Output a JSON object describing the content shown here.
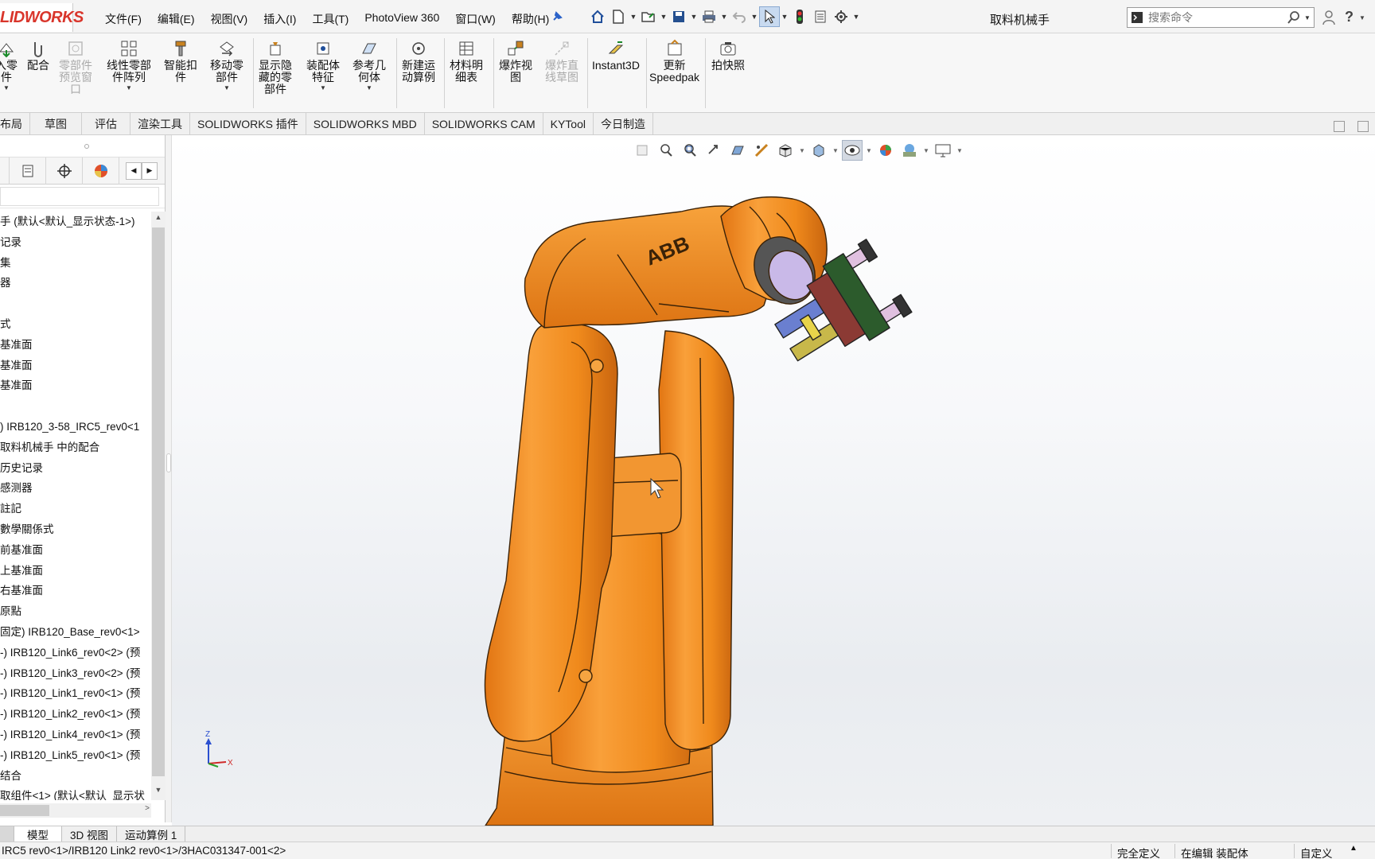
{
  "app": {
    "logo_text": "LIDWORKS",
    "document_title": "取料机械手"
  },
  "menu": [
    "文件(F)",
    "编辑(E)",
    "视图(V)",
    "插入(I)",
    "工具(T)",
    "PhotoView 360",
    "窗口(W)",
    "帮助(H)"
  ],
  "search": {
    "placeholder": "搜索命令"
  },
  "ribbon": {
    "buttons": [
      {
        "label": "入零\n件",
        "icon": "insert-part-icon"
      },
      {
        "label": "配合",
        "icon": "mate-icon"
      },
      {
        "label": "零部件\n预览窗\n口",
        "icon": "component-preview-icon",
        "disabled": true
      },
      {
        "label": "线性零部\n件阵列",
        "icon": "linear-pattern-icon"
      },
      {
        "label": "智能扣\n件",
        "icon": "smart-fastener-icon"
      },
      {
        "label": "移动零\n部件",
        "icon": "move-component-icon"
      },
      {
        "label": "显示隐\n藏的零\n部件",
        "icon": "show-hidden-icon"
      },
      {
        "label": "装配体\n特征",
        "icon": "assembly-feature-icon"
      },
      {
        "label": "参考几\n何体",
        "icon": "reference-geometry-icon"
      },
      {
        "label": "新建运\n动算例",
        "icon": "new-motion-study-icon"
      },
      {
        "label": "材料明\n细表",
        "icon": "bom-icon"
      },
      {
        "label": "爆炸视\n图",
        "icon": "exploded-view-icon"
      },
      {
        "label": "爆炸直\n线草图",
        "icon": "explode-line-sketch-icon",
        "disabled": true
      },
      {
        "label": "Instant3D",
        "icon": "instant3d-icon"
      },
      {
        "label": "更新\nSpeedpak",
        "icon": "speedpak-icon"
      },
      {
        "label": "拍快照",
        "icon": "snapshot-icon"
      }
    ]
  },
  "command_tabs": [
    "布局",
    "草图",
    "评估",
    "渲染工具",
    "SOLIDWORKS 插件",
    "SOLIDWORKS MBD",
    "SOLIDWORKS CAM",
    "KYTool",
    "今日制造"
  ],
  "feature_tree": [
    "手 (默认<默认_显示状态-1>)",
    "记录",
    "集",
    "器",
    "",
    "式",
    "基准面",
    "基准面",
    "基准面",
    "",
    ") IRB120_3-58_IRC5_rev0<1",
    "取料机械手 中的配合",
    "历史记录",
    "感测器",
    "註記",
    "數學關係式",
    "前基准面",
    "上基准面",
    "右基准面",
    "原點",
    "固定) IRB120_Base_rev0<1>",
    "-) IRB120_Link6_rev0<2> (预",
    "-) IRB120_Link3_rev0<2> (预",
    "-) IRB120_Link1_rev0<1> (预",
    "-) IRB120_Link2_rev0<1> (预",
    "-) IRB120_Link4_rev0<1> (预",
    "-) IRB120_Link5_rev0<1> (预",
    "结合",
    "取组件<1> (默认<默认_显示状"
  ],
  "robot": {
    "brand_text": "ABB",
    "body_color": "#f08a1c",
    "shadow_color": "#c9650f"
  },
  "bottom_tabs": [
    "模型",
    "3D 视图",
    "运动算例 1"
  ],
  "status": {
    "path": "IRC5 rev0<1>/IRB120 Link2 rev0<1>/3HAC031347-001<2>",
    "definition": "完全定义",
    "mode": "在编辑 装配体",
    "units": "自定义"
  },
  "triad": {
    "z": "Z",
    "x": "X"
  }
}
